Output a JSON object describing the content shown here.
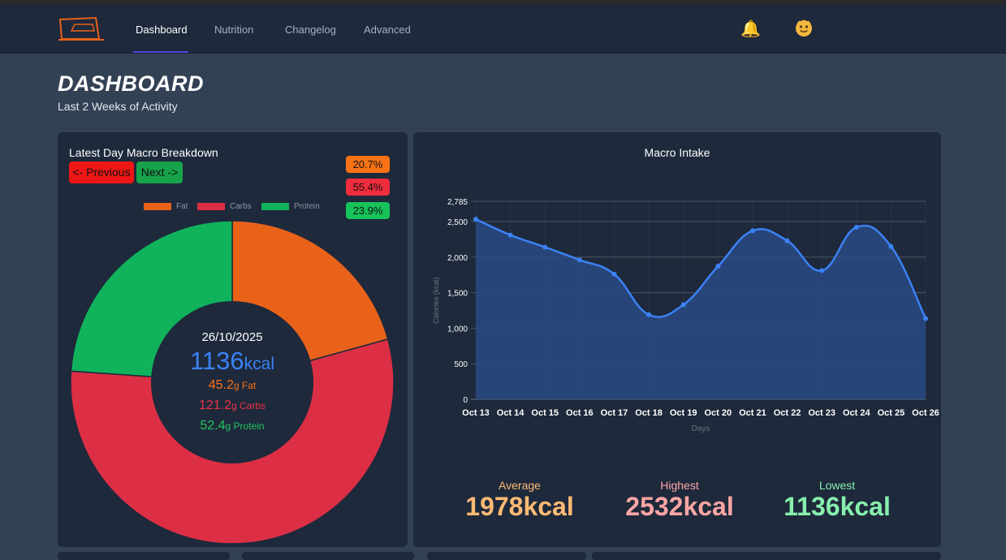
{
  "nav": {
    "items": [
      {
        "label": "Dashboard",
        "active": true
      },
      {
        "label": "Nutrition",
        "active": false
      },
      {
        "label": "Changelog",
        "active": false
      },
      {
        "label": "Advanced",
        "active": false
      }
    ],
    "icons": [
      "bell-icon",
      "avatar-icon"
    ]
  },
  "page": {
    "title": "DASHBOARD",
    "subtitle": "Last 2 Weeks of Activity"
  },
  "macro_card": {
    "title": "Latest Day Macro Breakdown",
    "prev_label": "<- Previous",
    "next_label": "Next ->",
    "percentages": [
      {
        "label": "20.7%",
        "color": "#f97316"
      },
      {
        "label": "55.4%",
        "color": "#ef2c3b"
      },
      {
        "label": "23.9%",
        "color": "#16c25a"
      }
    ],
    "legend": [
      {
        "label": "Fat",
        "color": "#e8621a"
      },
      {
        "label": "Carbs",
        "color": "#dc2f45"
      },
      {
        "label": "Protein",
        "color": "#10b35c"
      }
    ],
    "center": {
      "date": "26/10/2025",
      "kcal_value": "1136",
      "kcal_unit": "kcal",
      "fat_value": "45.2",
      "fat_unit": "g Fat",
      "carbs_value": "121.2",
      "carbs_unit": "g Carbs",
      "protein_value": "52.4",
      "protein_unit": "g Protein"
    }
  },
  "chart_data": {
    "type": "area",
    "title": "Macro Intake",
    "xlabel": "Days",
    "ylabel": "Calories (kcal)",
    "x": [
      "Oct 13",
      "Oct 14",
      "Oct 15",
      "Oct 16",
      "Oct 17",
      "Oct 18",
      "Oct 19",
      "Oct 20",
      "Oct 21",
      "Oct 22",
      "Oct 23",
      "Oct 24",
      "Oct 25",
      "Oct 26"
    ],
    "values": [
      2532,
      2310,
      2140,
      1960,
      1760,
      1190,
      1330,
      1870,
      2370,
      2230,
      1810,
      2420,
      2150,
      1136
    ],
    "yticks": [
      "0",
      "500",
      "1,000",
      "1,500",
      "2,000",
      "2,500",
      "2,785"
    ],
    "ylim": [
      0,
      2785
    ],
    "grid": true,
    "line_color": "#3b82f6"
  },
  "stats": {
    "average_label": "Average",
    "average_value": "1978kcal",
    "highest_label": "Highest",
    "highest_value": "2532kcal",
    "lowest_label": "Lowest",
    "lowest_value": "1136kcal"
  }
}
